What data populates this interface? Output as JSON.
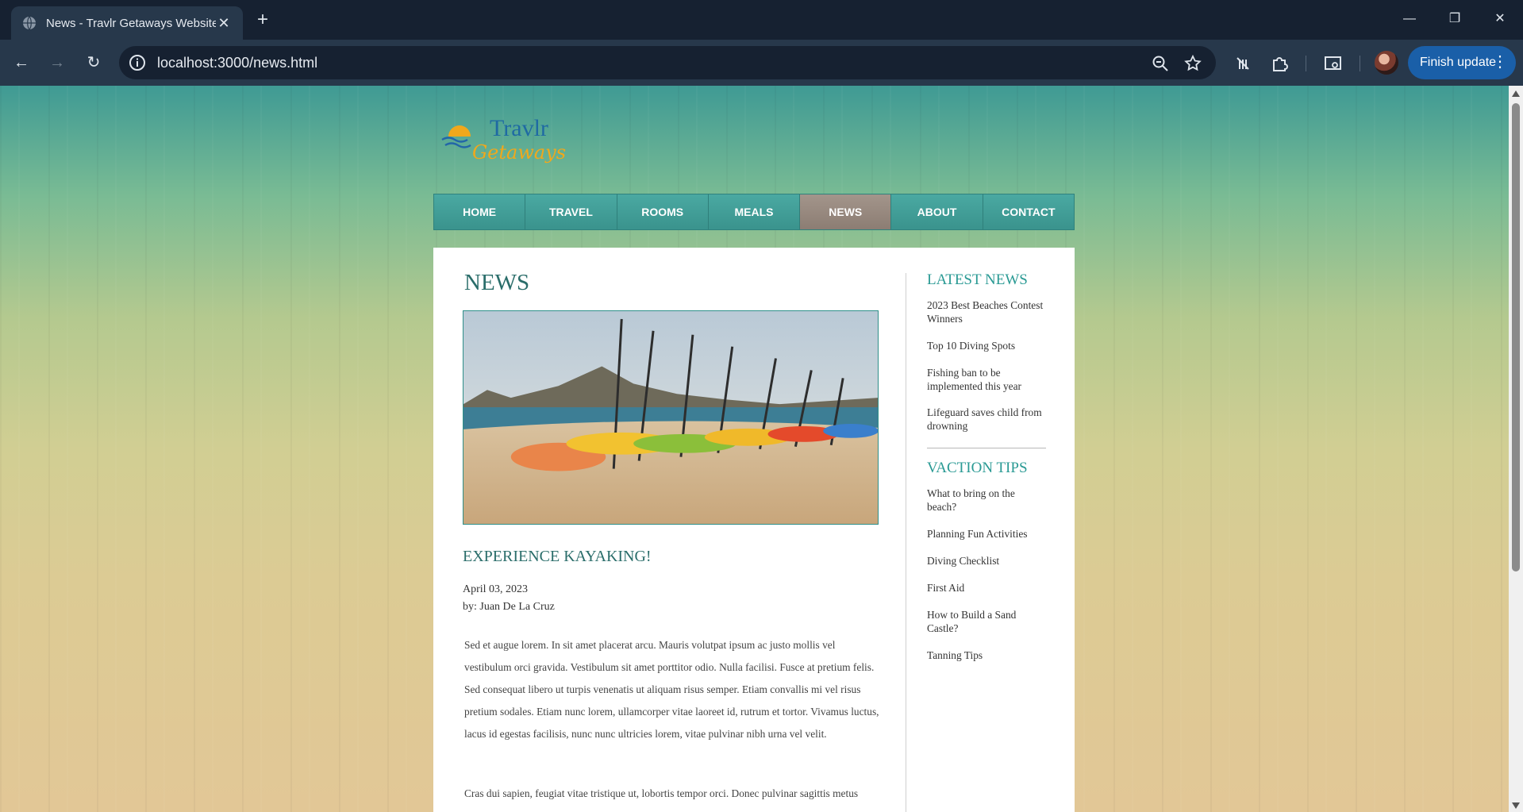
{
  "browser": {
    "tab_title": "News - Travlr Getaways Website",
    "url": "localhost:3000/news.html",
    "update_label": "Finish update"
  },
  "site": {
    "logo_line1": "Travlr",
    "logo_line2": "Getaways",
    "nav": [
      {
        "label": "HOME",
        "active": false
      },
      {
        "label": "TRAVEL",
        "active": false
      },
      {
        "label": "ROOMS",
        "active": false
      },
      {
        "label": "MEALS",
        "active": false
      },
      {
        "label": "NEWS",
        "active": true
      },
      {
        "label": "ABOUT",
        "active": false
      },
      {
        "label": "CONTACT",
        "active": false
      }
    ],
    "colors": {
      "accent": "#3d9c96",
      "active_nav": "#9a8b80",
      "heading": "#2a6d6a"
    }
  },
  "main": {
    "page_title": "NEWS",
    "article": {
      "title": "EXPERIENCE KAYAKING!",
      "date": "April 03, 2023",
      "author": "by: Juan De La Cruz",
      "paragraphs": [
        "Sed et augue lorem. In sit amet placerat arcu. Mauris volutpat ipsum ac justo mollis vel vestibulum orci gravida. Vestibulum sit amet porttitor odio. Nulla facilisi. Fusce at pretium felis. Sed consequat libero ut turpis venenatis ut aliquam risus semper. Etiam convallis mi vel risus pretium sodales. Etiam nunc lorem, ullamcorper vitae laoreet id, rutrum et tortor. Vivamus luctus, lacus id egestas facilisis, nunc nunc ultricies lorem, vitae pulvinar nibh urna vel velit.",
        "Cras dui sapien, feugiat vitae tristique ut, lobortis tempor orci. Donec pulvinar sagittis metus"
      ]
    }
  },
  "sidebar": {
    "latest_heading": "LATEST NEWS",
    "latest": [
      "2023 Best Beaches Contest Winners",
      "Top 10 Diving Spots",
      "Fishing ban to be implemented this year",
      "Lifeguard saves child from drowning"
    ],
    "tips_heading": "VACTION TIPS",
    "tips": [
      "What to bring on the beach?",
      "Planning Fun Activities",
      "Diving Checklist",
      "First Aid",
      "How to Build a Sand Castle?",
      "Tanning Tips"
    ]
  }
}
